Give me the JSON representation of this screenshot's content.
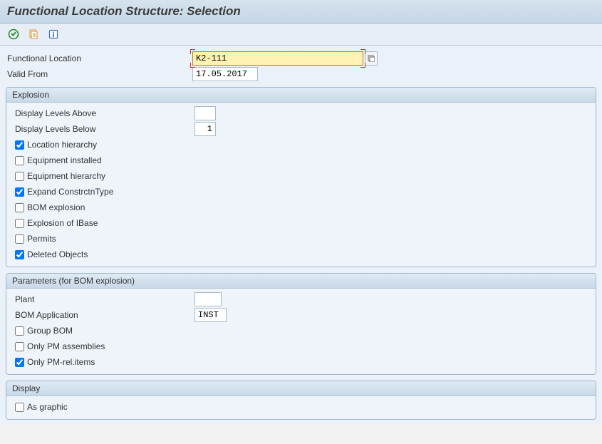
{
  "header": {
    "title": "Functional Location Structure: Selection"
  },
  "toolbar": {
    "execute": "execute-icon",
    "variants": "variants-icon",
    "info": "info-icon"
  },
  "selection": {
    "funcloc_label": "Functional Location",
    "funcloc_value": "K2-111",
    "validfrom_label": "Valid From",
    "validfrom_value": "17.05.2017"
  },
  "explosion": {
    "title": "Explosion",
    "levels_above_label": "Display Levels Above",
    "levels_above_value": "",
    "levels_below_label": "Display Levels Below",
    "levels_below_value": "1",
    "checks": {
      "loc_hier": {
        "label": "Location hierarchy",
        "checked": true
      },
      "eq_inst": {
        "label": "Equipment installed",
        "checked": false
      },
      "eq_hier": {
        "label": "Equipment hierarchy",
        "checked": false
      },
      "exp_ctype": {
        "label": "Expand ConstrctnType",
        "checked": true
      },
      "bom_exp": {
        "label": "BOM explosion",
        "checked": false
      },
      "ibase_exp": {
        "label": "Explosion of IBase",
        "checked": false
      },
      "permits": {
        "label": "Permits",
        "checked": false
      },
      "del_obj": {
        "label": "Deleted Objects",
        "checked": true
      }
    }
  },
  "params": {
    "title": "Parameters (for BOM explosion)",
    "plant_label": "Plant",
    "plant_value": "",
    "bomapp_label": "BOM Application",
    "bomapp_value": "INST",
    "checks": {
      "group_bom": {
        "label": "Group BOM",
        "checked": false
      },
      "pm_assemb": {
        "label": "Only PM assemblies",
        "checked": false
      },
      "pm_rel_items": {
        "label": "Only PM-rel.items",
        "checked": true
      }
    }
  },
  "display": {
    "title": "Display",
    "checks": {
      "as_graphic": {
        "label": "As graphic",
        "checked": false
      }
    }
  }
}
